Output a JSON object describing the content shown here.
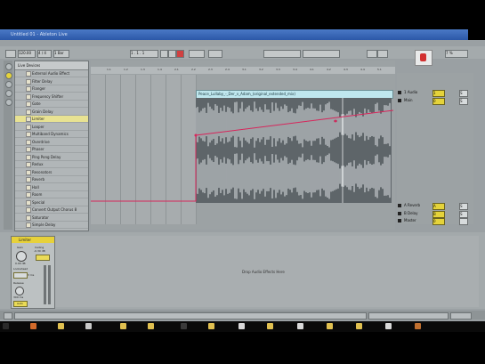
{
  "window": {
    "title": "Untitled 01 - Ableton Live"
  },
  "toolbar": {
    "tempo": "120.00",
    "meter": "4 / 4",
    "quantize": "1 Bar",
    "position": "1 . 1 . 1",
    "cpu": "7 %"
  },
  "browser": {
    "header": "Live Devices",
    "items": [
      {
        "label": "External Audio Effect",
        "selected": false
      },
      {
        "label": "Filter Delay",
        "selected": false
      },
      {
        "label": "Flanger",
        "selected": false
      },
      {
        "label": "Frequency Shifter",
        "selected": false
      },
      {
        "label": "Gate",
        "selected": false
      },
      {
        "label": "Grain Delay",
        "selected": false
      },
      {
        "label": "Limiter",
        "selected": true
      },
      {
        "label": "Looper",
        "selected": false
      },
      {
        "label": "Multiband Dynamics",
        "selected": false
      },
      {
        "label": "Overdrive",
        "selected": false
      },
      {
        "label": "Phaser",
        "selected": false
      },
      {
        "label": "Ping Pong Delay",
        "selected": false
      },
      {
        "label": "Redux",
        "selected": false
      },
      {
        "label": "Resonators",
        "selected": false
      },
      {
        "label": "Reverb",
        "selected": false
      },
      {
        "label": "Hall",
        "selected": false
      },
      {
        "label": "Room",
        "selected": false
      },
      {
        "label": "Special",
        "selected": false
      },
      {
        "label": "Convert Output Chorus 8",
        "selected": false
      },
      {
        "label": "Saturator",
        "selected": false
      },
      {
        "label": "Simple Delay",
        "selected": false
      }
    ]
  },
  "ruler": {
    "ticks": [
      "1.1",
      "1.2",
      "1.3",
      "1.4",
      "2.1",
      "2.2",
      "2.3",
      "2.4",
      "3.1",
      "3.2",
      "3.3",
      "3.4",
      "4.1",
      "4.2",
      "4.3",
      "4.4",
      "5.1"
    ]
  },
  "clip": {
    "name": "Peace_Lullaby_-_Der_v_Adam_(original_extended_mix)"
  },
  "tracks": [
    {
      "name": "1 Audio",
      "value": "1",
      "state": "S"
    },
    {
      "name": "Main",
      "value": "0",
      "state": "S"
    },
    {
      "name": "A Reverb",
      "value": "A",
      "state": "S"
    },
    {
      "name": "B Delay",
      "value": "B",
      "state": "S"
    },
    {
      "name": "Master",
      "value": "0",
      "state": ""
    }
  ],
  "device": {
    "name": "Limiter",
    "gain_label": "Gain",
    "gain_value": "0.00 dB",
    "ceiling_label": "Ceiling",
    "ceiling_value": "-0.30 dB",
    "lookahead_label": "Lookahead",
    "lookahead_value": "3 ms",
    "release_label": "Release",
    "release_value": "300 ms",
    "auto_label": "Auto",
    "drop_text": "Drop Audio Effects Here"
  },
  "colors": {
    "accent": "#e5d33a",
    "clip_header": "#bfe7ee",
    "automation": "#d7265b",
    "waveform_bg": "#5e6569"
  }
}
